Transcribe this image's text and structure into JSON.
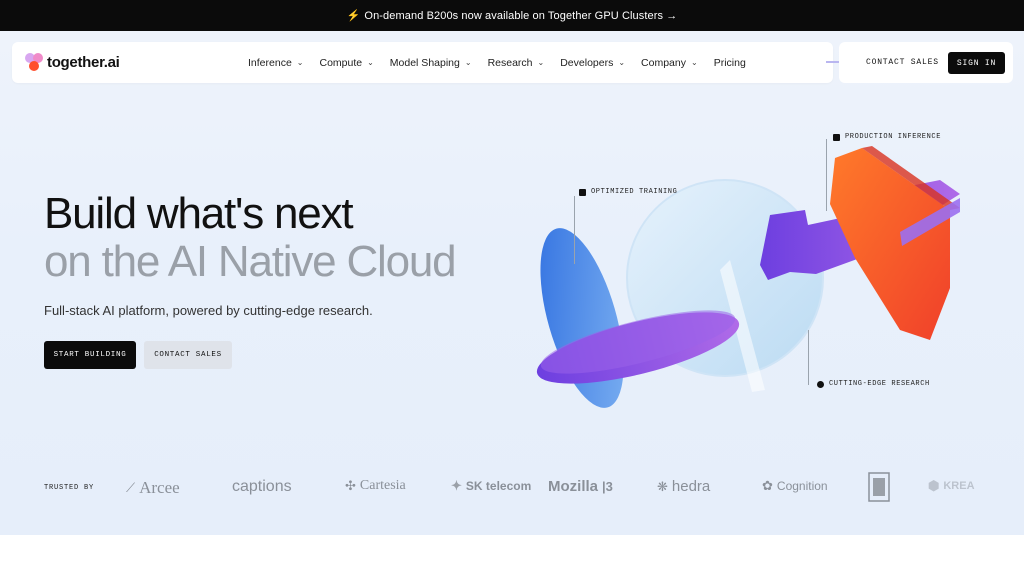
{
  "announcement": {
    "icon": "lightning-icon",
    "text": "On-demand B200s now available on Together GPU Clusters →"
  },
  "nav": {
    "logo_text": "together.ai",
    "items": [
      {
        "label": "Inference",
        "has_dropdown": true
      },
      {
        "label": "Compute",
        "has_dropdown": true
      },
      {
        "label": "Model Shaping",
        "has_dropdown": true
      },
      {
        "label": "Research",
        "has_dropdown": true
      },
      {
        "label": "Developers",
        "has_dropdown": true
      },
      {
        "label": "Company",
        "has_dropdown": true
      },
      {
        "label": "Pricing",
        "has_dropdown": false
      }
    ],
    "contact_sales": "CONTACT SALES",
    "sign_in": "SIGN IN"
  },
  "hero": {
    "headline_line1": "Build what's next",
    "headline_line2": "on the AI Native Cloud",
    "subheadline": "Full-stack AI platform, powered by cutting-edge research.",
    "start_button": "START BUILDING",
    "contact_button": "CONTACT SALES",
    "callouts": {
      "optimized_training": "OPTIMIZED TRAINING",
      "production_inference": "PRODUCTION INFERENCE",
      "cutting_edge_research": "CUTTING-EDGE RESEARCH"
    }
  },
  "trusted": {
    "label": "TRUSTED BY",
    "logos": [
      "Arcee",
      "captions",
      "Cartesia",
      "SK telecom",
      "Mozilla",
      "hedra",
      "Cognition",
      "KREA"
    ]
  },
  "colors": {
    "announcement_bg": "#0b0b0b",
    "hero_bg": "#e8f0fb",
    "headline_primary": "#111111",
    "headline_secondary": "#9aa0a8",
    "accent_orange": "#ff5a24",
    "accent_purple": "#8a4fe0",
    "accent_blue": "#3f7ee0"
  }
}
